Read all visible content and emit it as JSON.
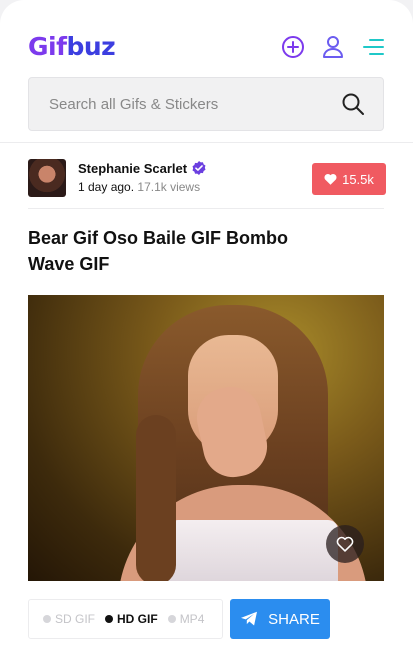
{
  "header": {
    "logo_gif": "Gif",
    "logo_buz": "buz",
    "icons": [
      "add-circle-icon",
      "user-icon",
      "menu-icon"
    ]
  },
  "search": {
    "placeholder": "Search all Gifs & Stickers",
    "value": ""
  },
  "post": {
    "author_name": "Stephanie Scarlet",
    "time": "1 day ago.",
    "views": "17.1k views",
    "likes": "15.5k",
    "title": "Bear Gif Oso Baile GIF Bombo Wave GIF"
  },
  "formats": [
    {
      "label": "SD GIF",
      "active": false
    },
    {
      "label": "HD GIF",
      "active": true
    },
    {
      "label": "MP4",
      "active": false
    }
  ],
  "share_label": "SHARE",
  "colors": {
    "brand_purple": "#7c3aed",
    "like_red": "#f05a61",
    "share_blue": "#2b8def",
    "menu_teal": "#1fc8c8"
  }
}
